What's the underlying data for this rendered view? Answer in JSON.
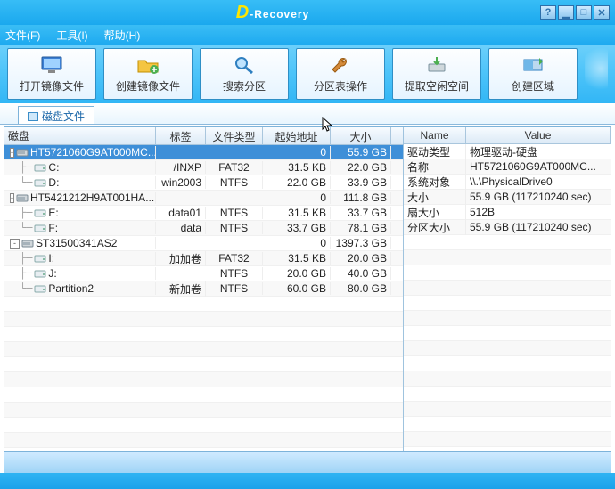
{
  "window": {
    "app_title_prefix": "D",
    "app_title_rest": "-Recovery"
  },
  "menu": {
    "file": "文件(F)",
    "tools": "工具(I)",
    "help": "帮助(H)"
  },
  "toolbar": {
    "open_image": "打开镜像文件",
    "create_image": "创建镜像文件",
    "search_partition": "搜索分区",
    "partition_ops": "分区表操作",
    "extract_free": "提取空闲空间",
    "create_region": "创建区域"
  },
  "tab": {
    "label": "磁盘文件"
  },
  "left": {
    "headers": {
      "disk": "磁盘",
      "label": "标签",
      "fstype": "文件类型",
      "start": "起始地址",
      "size": "大小"
    },
    "rows": [
      {
        "kind": "disk",
        "selected": true,
        "toggle": "-",
        "name": "HT5721060G9AT000MC...",
        "label": "",
        "fs": "",
        "start": "0",
        "size": "55.9 GB"
      },
      {
        "kind": "drive",
        "indent": 1,
        "branch": "├",
        "name": "C:",
        "label": "/INXP",
        "fs": "FAT32",
        "start": "31.5 KB",
        "size": "22.0 GB"
      },
      {
        "kind": "drive",
        "indent": 1,
        "branch": "└",
        "name": "D:",
        "label": "win2003",
        "fs": "NTFS",
        "start": "22.0 GB",
        "size": "33.9 GB"
      },
      {
        "kind": "disk",
        "toggle": "-",
        "name": "HT5421212H9AT001HA...",
        "label": "",
        "fs": "",
        "start": "0",
        "size": "111.8 GB"
      },
      {
        "kind": "drive",
        "indent": 1,
        "branch": "├",
        "name": "E:",
        "label": "data01",
        "fs": "NTFS",
        "start": "31.5 KB",
        "size": "33.7 GB"
      },
      {
        "kind": "drive",
        "indent": 1,
        "branch": "└",
        "name": "F:",
        "label": "data",
        "fs": "NTFS",
        "start": "33.7 GB",
        "size": "78.1 GB"
      },
      {
        "kind": "disk",
        "toggle": "-",
        "name": "ST31500341AS2",
        "label": "",
        "fs": "",
        "start": "0",
        "size": "1397.3 GB"
      },
      {
        "kind": "drive",
        "indent": 1,
        "branch": "├",
        "name": "I:",
        "label": "加加卷",
        "fs": "FAT32",
        "start": "31.5 KB",
        "size": "20.0 GB"
      },
      {
        "kind": "drive",
        "indent": 1,
        "branch": "├",
        "name": "J:",
        "label": "",
        "fs": "NTFS",
        "start": "20.0 GB",
        "size": "40.0 GB"
      },
      {
        "kind": "drive",
        "indent": 1,
        "branch": "└",
        "name": "Partition2",
        "label": "新加卷",
        "fs": "NTFS",
        "start": "60.0 GB",
        "size": "80.0 GB"
      }
    ]
  },
  "right": {
    "headers": {
      "name": "Name",
      "value": "Value"
    },
    "rows": [
      {
        "name": "驱动类型",
        "value": "物理驱动-硬盘"
      },
      {
        "name": "名称",
        "value": "HT5721060G9AT000MC..."
      },
      {
        "name": "系统对象",
        "value": "\\\\.\\PhysicalDrive0"
      },
      {
        "name": "大小",
        "value": "55.9 GB (117210240 sec)"
      },
      {
        "name": "扇大小",
        "value": "512B"
      },
      {
        "name": "分区大小",
        "value": "55.9 GB (117210240 sec)"
      }
    ]
  }
}
